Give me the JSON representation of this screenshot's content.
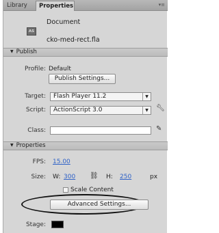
{
  "tabs": [
    {
      "label": "Library"
    },
    {
      "label": "Properties"
    }
  ],
  "document": {
    "type_label": "Document",
    "icon_text": "AS",
    "file_name": "cko-med-rect.fla"
  },
  "publish": {
    "header": "Publish",
    "profile_label": "Profile:",
    "profile_value": "Default",
    "publish_settings_button": "Publish Settings...",
    "target_label": "Target:",
    "target_value": "Flash Player 11.2",
    "script_label": "Script:",
    "script_value": "ActionScript 3.0",
    "class_label": "Class:",
    "class_value": ""
  },
  "properties": {
    "header": "Properties",
    "fps_label": "FPS:",
    "fps_value": "15.00",
    "size_label": "Size:",
    "w_label": "W:",
    "w_value": "300",
    "h_label": "H:",
    "h_value": "250",
    "unit": "px",
    "scale_content_label": "Scale Content",
    "advanced_settings_button": "Advanced Settings...",
    "stage_label": "Stage:",
    "stage_color": "#000000"
  },
  "icons": {
    "tab_menu": "panel-menu-icon",
    "target_dropdown": "chevron-down-icon",
    "script_dropdown": "chevron-down-icon",
    "script_settings": "wrench-icon",
    "class_edit": "pencil-icon",
    "link_size": "link-icon"
  }
}
